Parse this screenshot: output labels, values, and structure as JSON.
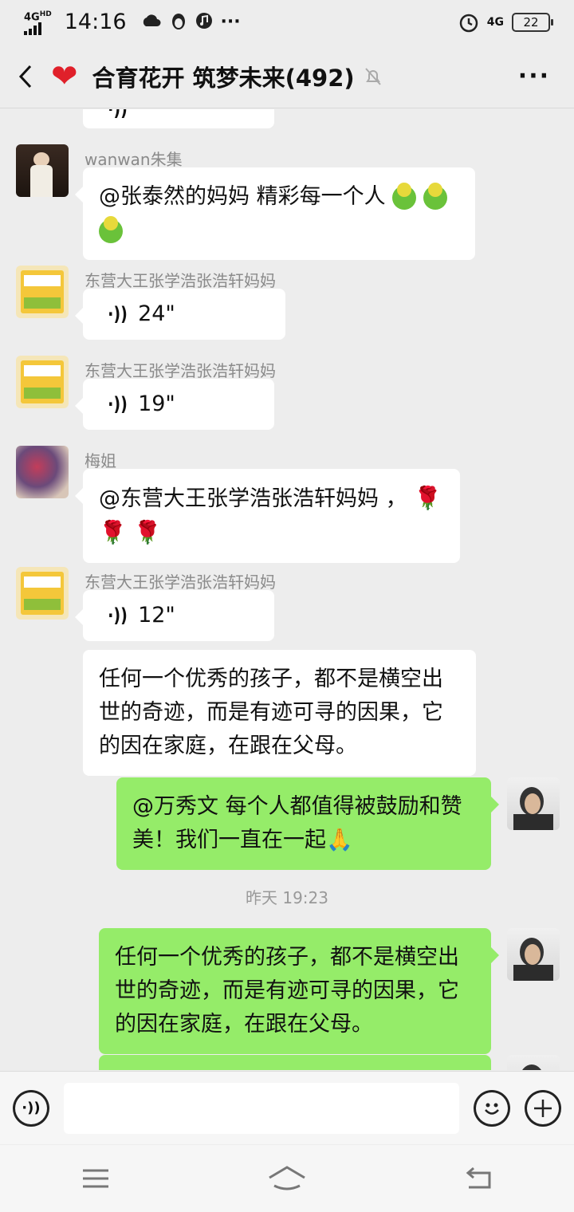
{
  "status": {
    "net": "4G",
    "net_sub": "HD",
    "time": "14:16",
    "more": "···",
    "net_right": "4G",
    "battery": "22"
  },
  "header": {
    "title": "合育花开 筑梦未来(492)",
    "more": "···"
  },
  "messages": [
    {
      "sender": "wanwan朱集",
      "text": "@张泰然的妈妈  精彩每一个人"
    },
    {
      "sender": "东营大王张学浩张浩轩妈妈",
      "voice": "24\""
    },
    {
      "sender": "东营大王张学浩张浩轩妈妈",
      "voice": "19\""
    },
    {
      "sender": "梅姐",
      "text": "@东营大王张学浩张浩轩妈妈 ，"
    },
    {
      "sender": "东营大王张学浩张浩轩妈妈",
      "voice": "12\""
    },
    {
      "text": "任何一个优秀的孩子，都不是横空出世的奇迹，而是有迹可寻的因果，它的因在家庭，在跟在父母。"
    },
    {
      "text": "@万秀文  每个人都值得被鼓励和赞美！我们一直在一起🙏"
    },
    {
      "timestamp": "昨天 19:23"
    },
    {
      "text": "任何一个优秀的孩子，都不是横空出世的奇迹，而是有迹可寻的因果，它的因在家庭，在跟在父母。"
    }
  ],
  "input": {
    "value": ""
  },
  "colors": {
    "accent_green": "#95ec69",
    "background": "#ededed"
  }
}
